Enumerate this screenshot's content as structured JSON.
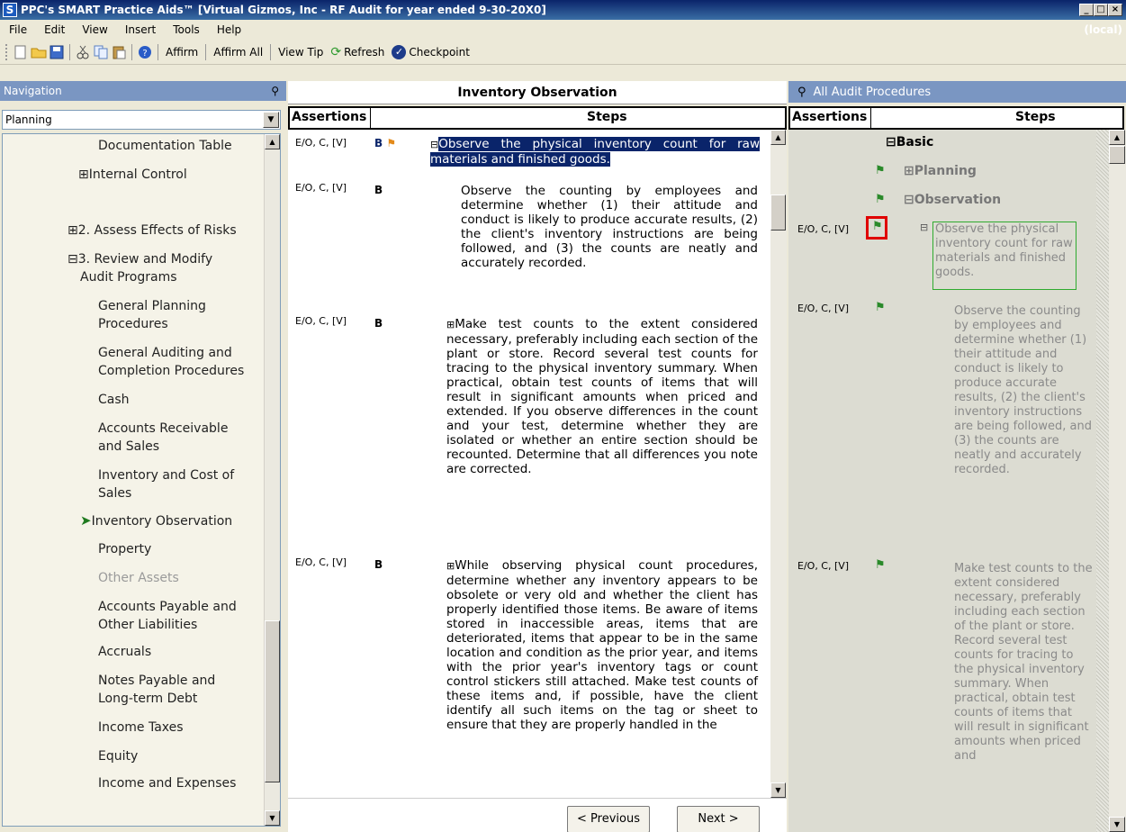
{
  "window": {
    "title": "PPC's SMART Practice Aids™ [Virtual Gizmos, Inc - RF Audit for year ended 9-30-20X0]",
    "logo_letter": "S"
  },
  "menu": {
    "items": [
      "File",
      "Edit",
      "View",
      "Insert",
      "Tools",
      "Help"
    ],
    "local_label": "(local)"
  },
  "toolbar": {
    "affirm": "Affirm",
    "affirm_all": "Affirm All",
    "view_tip": "View Tip",
    "refresh": "Refresh",
    "checkpoint": "Checkpoint"
  },
  "navigation": {
    "header": "Navigation",
    "selected_value": "Planning",
    "items": [
      {
        "label": "Documentation Table"
      },
      {
        "label": "⊞Internal Control"
      },
      {
        "label": "⊞2. Assess Effects of Risks"
      },
      {
        "label": "⊟3. Review and Modify"
      },
      {
        "label": "Audit Programs"
      },
      {
        "label": "General Planning"
      },
      {
        "label": "Procedures"
      },
      {
        "label": "General Auditing and"
      },
      {
        "label": "Completion Procedures"
      },
      {
        "label": "Cash"
      },
      {
        "label": "Accounts Receivable"
      },
      {
        "label": "and Sales"
      },
      {
        "label": "Inventory  and Cost of"
      },
      {
        "label": "Sales"
      },
      {
        "label": "Inventory  Observation"
      },
      {
        "label": "Property"
      },
      {
        "label": "Other Assets"
      },
      {
        "label": "Accounts Payable and"
      },
      {
        "label": "Other Liabilities"
      },
      {
        "label": "Accruals"
      },
      {
        "label": "Notes Payable and"
      },
      {
        "label": "Long-term Debt"
      },
      {
        "label": "Income Taxes"
      },
      {
        "label": "Equity"
      },
      {
        "label": "Income and Expenses"
      }
    ]
  },
  "center": {
    "title": "Inventory Observation",
    "col_assertions": "Assertions",
    "col_steps": "Steps",
    "rows": [
      {
        "assertion": "E/O, C, [V]",
        "badge": "B",
        "step": "Observe the physical inventory count for raw materials and finished goods."
      },
      {
        "assertion": "E/O, C, [V]",
        "badge": "B",
        "step": "Observe the counting by employees and determine whether (1) their attitude and conduct is likely to produce accurate results, (2) the client's inventory instructions are being followed, and (3) the counts are neatly and accurately recorded."
      },
      {
        "assertion": "E/O, C, [V]",
        "badge": "B",
        "step": "Make test counts to the extent considered necessary, preferably including each section of the plant or store. Record several test counts for tracing to the physical inventory summary. When practical, obtain test counts of items that will result in significant amounts when priced and extended. If you observe differences in the count and your test, determine whether they are isolated or whether an entire section should be recounted. Determine that all differences you note are corrected."
      },
      {
        "assertion": "E/O, C, [V]",
        "badge": "B",
        "step": "While observing physical count procedures, determine whether any inventory appears to be obsolete or very old and whether the client has properly identified those items. Be aware of items stored in inaccessible areas, items that are deteriorated, items that appear to be in the same location and condition as the prior year, and items with the prior year's inventory tags or count control stickers still attached. Make test counts of these items and, if possible, have the client identify all such items on the tag or sheet to ensure that they are properly handled in the"
      }
    ],
    "prev_button": "< Previous",
    "next_button": "Next >"
  },
  "right": {
    "header": "All Audit Procedures",
    "col_assertions": "Assertions",
    "col_steps": "Steps",
    "tree_basic": "⊟Basic",
    "tree_planning": "⊞Planning",
    "tree_observation": "⊟Observation",
    "rows": [
      {
        "assertion": "E/O, C, [V]",
        "step": "Observe the physical inventory count for raw materials and finished goods."
      },
      {
        "assertion": "E/O, C, [V]",
        "step": "Observe the counting by employees and determine whether (1) their attitude and conduct is likely to produce accurate results, (2) the client's inventory instructions are being followed, and (3) the counts are neatly and accurately recorded."
      },
      {
        "assertion": "E/O, C, [V]",
        "step": "Make test counts to the extent considered necessary, preferably including each section of the plant or store. Record several test counts for tracing to the physical inventory summary. When practical, obtain test counts of items that will result in significant amounts when priced and"
      }
    ]
  },
  "colors": {
    "title_bar": "#0a246a",
    "pane_header": "#7a96c2",
    "selection": "#0a246a",
    "flag_green": "#2a8a2a",
    "highlight_red": "#e00000"
  }
}
